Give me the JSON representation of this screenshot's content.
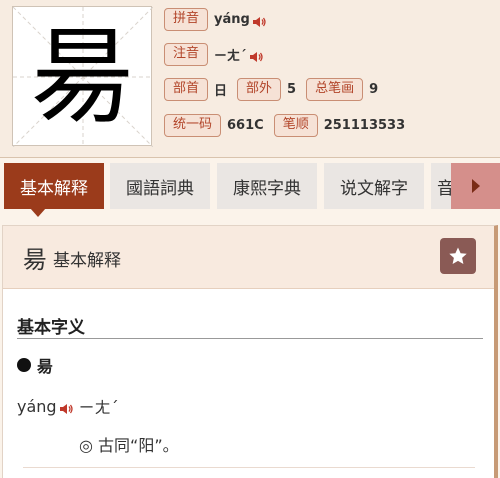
{
  "header": {
    "character": "昜",
    "pinyin_label": "拼音",
    "pinyin_value": "yáng",
    "zhuyin_label": "注音",
    "zhuyin_value": "ㄧㄤˊ",
    "radical_label": "部首",
    "radical_value": "日",
    "outer_strokes_label": "部外",
    "outer_strokes_value": "5",
    "total_strokes_label": "总笔画",
    "total_strokes_value": "9",
    "unicode_label": "统一码",
    "unicode_value": "661C",
    "stroke_order_label": "笔顺",
    "stroke_order_value": "251113533",
    "sound_icon": "speaker-icon"
  },
  "tabs": [
    {
      "label": "基本解释",
      "active": true
    },
    {
      "label": "國語詞典",
      "active": false
    },
    {
      "label": "康熙字典",
      "active": false
    },
    {
      "label": "说文解字",
      "active": false
    },
    {
      "label": "音",
      "active": false
    }
  ],
  "tab_next_icon": "chevron-right-icon",
  "card": {
    "character": "昜",
    "title": "基本解释",
    "section_title": "基本字义",
    "bullet_char": "昜",
    "pinyin": "yáng",
    "bopomofo": "ㄧㄤˊ",
    "meaning": "◎ 古同“阳”。",
    "star_icon": "star-icon"
  },
  "colors": {
    "accent": "#9b3b1b",
    "tag_text": "#b2452a",
    "star_button": "#8a5a55",
    "next_button": "#d58f8b"
  }
}
